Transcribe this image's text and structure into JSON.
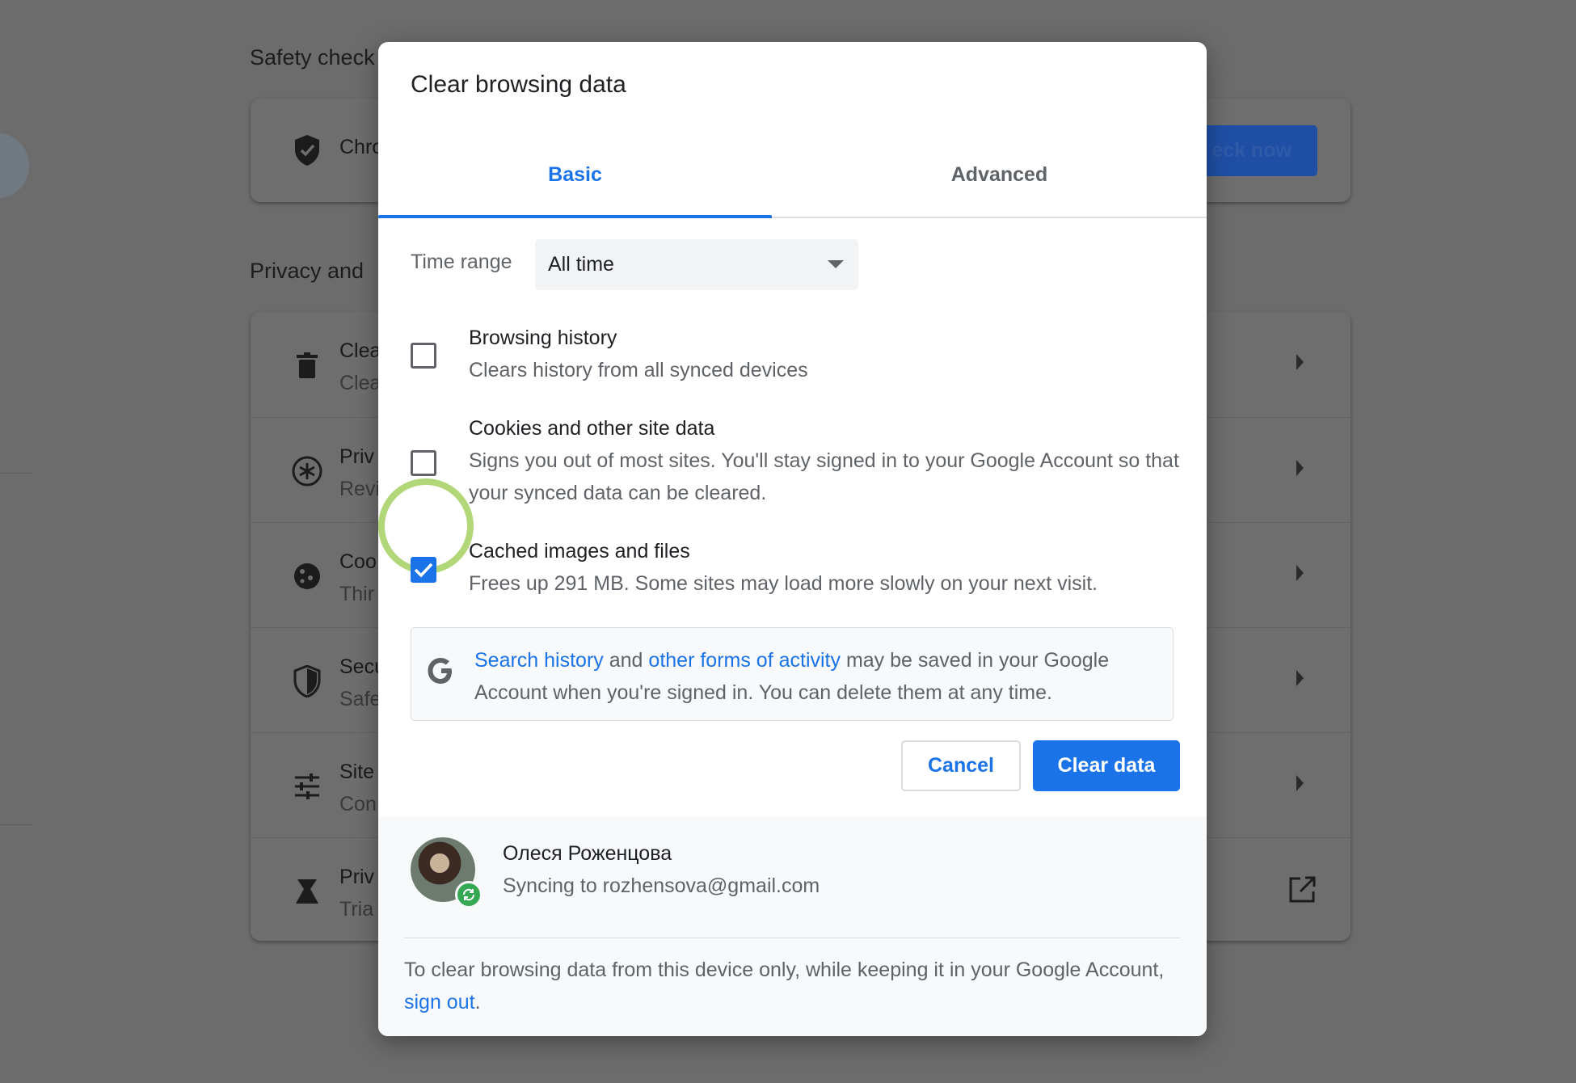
{
  "background": {
    "safety_check_title": "Safety check",
    "safety_row_title": "Chro",
    "check_now_label": "eck now",
    "privacy_title": "Privacy and",
    "privacy_rows": [
      {
        "title": "Clea",
        "sub": "Clea",
        "icon": "trash-icon"
      },
      {
        "title": "Priv",
        "sub": "Revi",
        "icon": "privacy-guide-icon"
      },
      {
        "title": "Coo",
        "sub": "Thir",
        "icon": "cookie-icon"
      },
      {
        "title": "Secu",
        "sub": "Safe",
        "icon": "security-shield-icon"
      },
      {
        "title": "Site",
        "sub": "Con",
        "icon": "sliders-icon"
      },
      {
        "title": "Priv",
        "sub": "Tria",
        "icon": "flask-icon"
      }
    ]
  },
  "dialog": {
    "title": "Clear browsing data",
    "tabs": [
      {
        "label": "Basic",
        "active": true
      },
      {
        "label": "Advanced",
        "active": false
      }
    ],
    "time_range": {
      "label": "Time range",
      "value": "All time"
    },
    "options": [
      {
        "title": "Browsing history",
        "description": "Clears history from all synced devices",
        "checked": false
      },
      {
        "title": "Cookies and other site data",
        "description": "Signs you out of most sites. You'll stay signed in to your Google Account so that your synced data can be cleared.",
        "checked": false
      },
      {
        "title": "Cached images and files",
        "description": "Frees up 291 MB. Some sites may load more slowly on your next visit.",
        "checked": true
      }
    ],
    "info": {
      "link1": "Search history",
      "and": "and",
      "link2": "other forms of activity",
      "rest": "may be saved in your Google Account when you're signed in. You can delete them at any time."
    },
    "buttons": {
      "cancel": "Cancel",
      "clear": "Clear data"
    },
    "account": {
      "name": "Олеся Роженцова",
      "sync_status": "Syncing to rozhensova@gmail.com"
    },
    "footer_note": {
      "text": "To clear browsing data from this device only, while keeping it in your Google Account,",
      "link": "sign out",
      "end": "."
    }
  },
  "colors": {
    "accent": "#1a73e8",
    "highlight_ring": "#a8d36a",
    "sync_green": "#34a853"
  }
}
